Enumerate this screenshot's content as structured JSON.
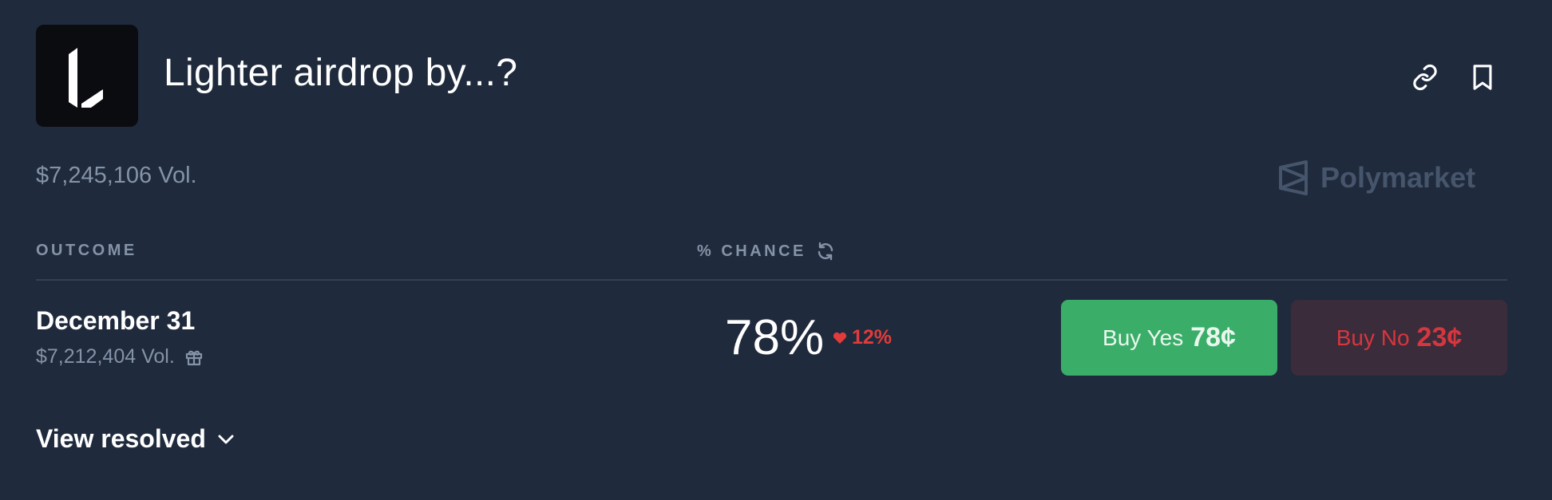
{
  "market": {
    "title": "Lighter airdrop by...?",
    "volume": "$7,245,106 Vol.",
    "logo_icon": "lighter-logo-icon"
  },
  "actions": {
    "link_icon": "link-icon",
    "bookmark_icon": "bookmark-icon"
  },
  "brand": {
    "name": "Polymarket",
    "icon": "polymarket-logo-icon"
  },
  "table": {
    "headers": {
      "outcome": "OUTCOME",
      "chance": "% CHANCE",
      "refresh_icon": "refresh-icon"
    },
    "rows": [
      {
        "name": "December 31",
        "volume": "$7,212,404 Vol.",
        "gift_icon": "gift-icon",
        "chance": "78%",
        "change": "12%",
        "change_direction": "down",
        "buy_yes_label": "Buy Yes",
        "buy_yes_price": "78¢",
        "buy_no_label": "Buy No",
        "buy_no_price": "23¢"
      }
    ]
  },
  "footer": {
    "view_resolved": "View resolved",
    "chevron_icon": "chevron-down-icon"
  },
  "colors": {
    "background": "#1f2a3c",
    "muted_text": "#8593a8",
    "yes_green": "#3aae69",
    "no_bg": "#3a2c3b",
    "no_red": "#d6363e",
    "down_red": "#e23b3b"
  }
}
